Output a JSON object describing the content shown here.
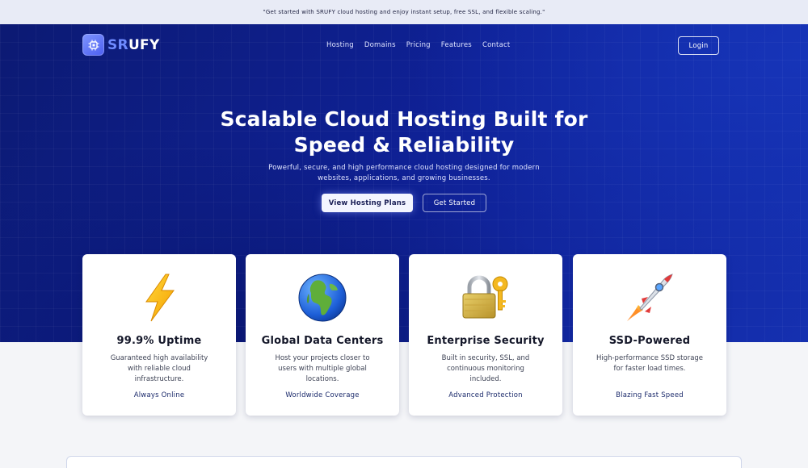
{
  "announcement": "\"Get started with SRUFY cloud hosting and enjoy instant setup, free SSL, and flexible scaling.\"",
  "logo": {
    "prefix": "SR",
    "suffix": "UFY"
  },
  "nav": {
    "items": [
      "Hosting",
      "Domains",
      "Pricing",
      "Features",
      "Contact"
    ],
    "login_label": "Login"
  },
  "hero": {
    "title_line1": "Scalable Cloud Hosting Built for",
    "title_line2": "Speed & Reliability",
    "subtitle_line1": "Powerful, secure, and high performance cloud hosting designed for modern",
    "subtitle_line2": "websites, applications, and growing businesses.",
    "primary_cta": "View Hosting Plans",
    "secondary_cta": "Get Started"
  },
  "features": [
    {
      "icon": "lightning-icon",
      "title": "99.9% Uptime",
      "desc": "Guaranteed high availability with reliable cloud infrastructure.",
      "tag": "Always Online"
    },
    {
      "icon": "globe-icon",
      "title": "Global Data Centers",
      "desc": "Host your projects closer to users with multiple global locations.",
      "tag": "Worldwide Coverage"
    },
    {
      "icon": "lock-key-icon",
      "title": "Enterprise Security",
      "desc": "Built in security, SSL, and continuous monitoring included.",
      "tag": "Advanced Protection"
    },
    {
      "icon": "rocket-icon",
      "title": "SSD-Powered",
      "desc": "High-performance SSD storage for faster load times.",
      "tag": "Blazing Fast Speed"
    }
  ],
  "colors": {
    "hero_dark": "#0c1a73",
    "hero_light": "#1530b0",
    "logo_accent": "#6f8bff",
    "tag_text": "#1b2a6b"
  }
}
